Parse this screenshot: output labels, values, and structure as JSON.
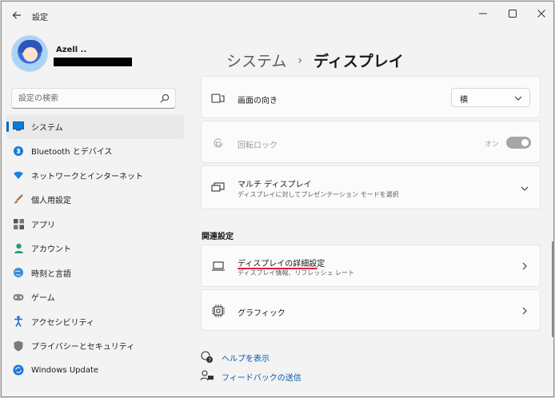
{
  "window": {
    "app_title": "設定"
  },
  "profile": {
    "name": "Azell .."
  },
  "search": {
    "placeholder": "設定の検索"
  },
  "sidebar": {
    "items": [
      {
        "label": "システム",
        "icon": "system-icon",
        "active": true
      },
      {
        "label": "Bluetooth とデバイス",
        "icon": "bluetooth-icon"
      },
      {
        "label": "ネットワークとインターネット",
        "icon": "wifi-icon"
      },
      {
        "label": "個人用設定",
        "icon": "brush-icon"
      },
      {
        "label": "アプリ",
        "icon": "apps-icon"
      },
      {
        "label": "アカウント",
        "icon": "account-icon"
      },
      {
        "label": "時刻と言語",
        "icon": "globe-clock-icon"
      },
      {
        "label": "ゲーム",
        "icon": "gamepad-icon"
      },
      {
        "label": "アクセシビリティ",
        "icon": "accessibility-icon"
      },
      {
        "label": "プライバシーとセキュリティ",
        "icon": "shield-icon"
      },
      {
        "label": "Windows Update",
        "icon": "windows-update-icon"
      }
    ]
  },
  "breadcrumb": {
    "parent": "システム",
    "separator": "›",
    "current": "ディスプレイ"
  },
  "settings": {
    "orientation": {
      "title": "画面の向き",
      "value": "横"
    },
    "rotation_lock": {
      "title": "回転ロック",
      "state": "オン"
    },
    "multi_display": {
      "title": "マルチ ディスプレイ",
      "subtitle": "ディスプレイに対してプレゼンテーション モードを選択"
    }
  },
  "related": {
    "section_title": "関連設定",
    "advanced_display": {
      "title": "ディスプレイの詳細設定",
      "subtitle": "ディスプレイ情報、リフレッシュ レート"
    },
    "graphics": {
      "title": "グラフィック"
    }
  },
  "links": {
    "help": "ヘルプを表示",
    "feedback": "フィードバックの送信"
  },
  "colors": {
    "accent": "#0067c0",
    "highlight_underline": "#e0203a",
    "link": "#0058a8"
  }
}
